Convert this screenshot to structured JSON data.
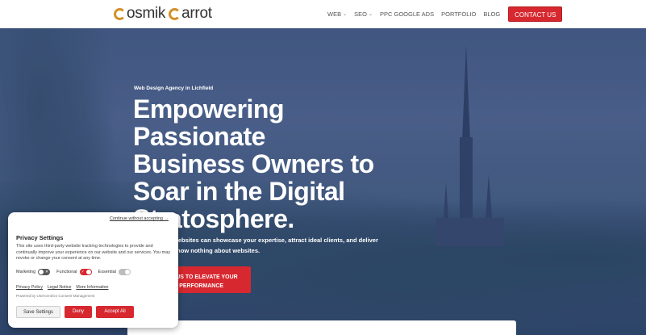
{
  "header": {
    "logo_part1": "osmik",
    "logo_part2": "arrot",
    "nav": [
      {
        "label": "WEB",
        "dropdown": true
      },
      {
        "label": "SEO",
        "dropdown": true
      },
      {
        "label": "PPC GOOGLE ADS",
        "dropdown": false
      },
      {
        "label": "PORTFOLIO",
        "dropdown": false
      },
      {
        "label": "BLOG",
        "dropdown": false
      }
    ],
    "contact_label": "CONTACT US",
    "chevron": "⌄"
  },
  "hero": {
    "tagline": "Web Design Agency in Lichfield",
    "headline": "Empowering Passionate Business Owners to Soar in the Digital Stratosphere.",
    "subtext": "websites can showcase your expertise, attract ideal clients, and deliver know nothing about websites.",
    "cta_label": "ITH US TO ELEVATE YOUR TE'S PERFORMANCE"
  },
  "privacy": {
    "continue_link": "Continue without accepting →",
    "title": "Privacy Settings",
    "description": "This site uses third-party website tracking technologies to provide and continually improve your experience on our website and our services. You may revoke or change your consent at any time.",
    "toggles": [
      {
        "label": "Marketing",
        "state": "off"
      },
      {
        "label": "Functional",
        "state": "on"
      },
      {
        "label": "Essential",
        "state": "disabled"
      }
    ],
    "links": [
      "Privacy Policy",
      "Legal Notice",
      "More Information"
    ],
    "powered_by": "Powered by Usercentrics Consent Management",
    "buttons": {
      "save": "Save Settings",
      "deny": "Deny",
      "accept": "Accept All"
    }
  },
  "colors": {
    "accent": "#d7282f",
    "logo_c": "#d4902a"
  }
}
